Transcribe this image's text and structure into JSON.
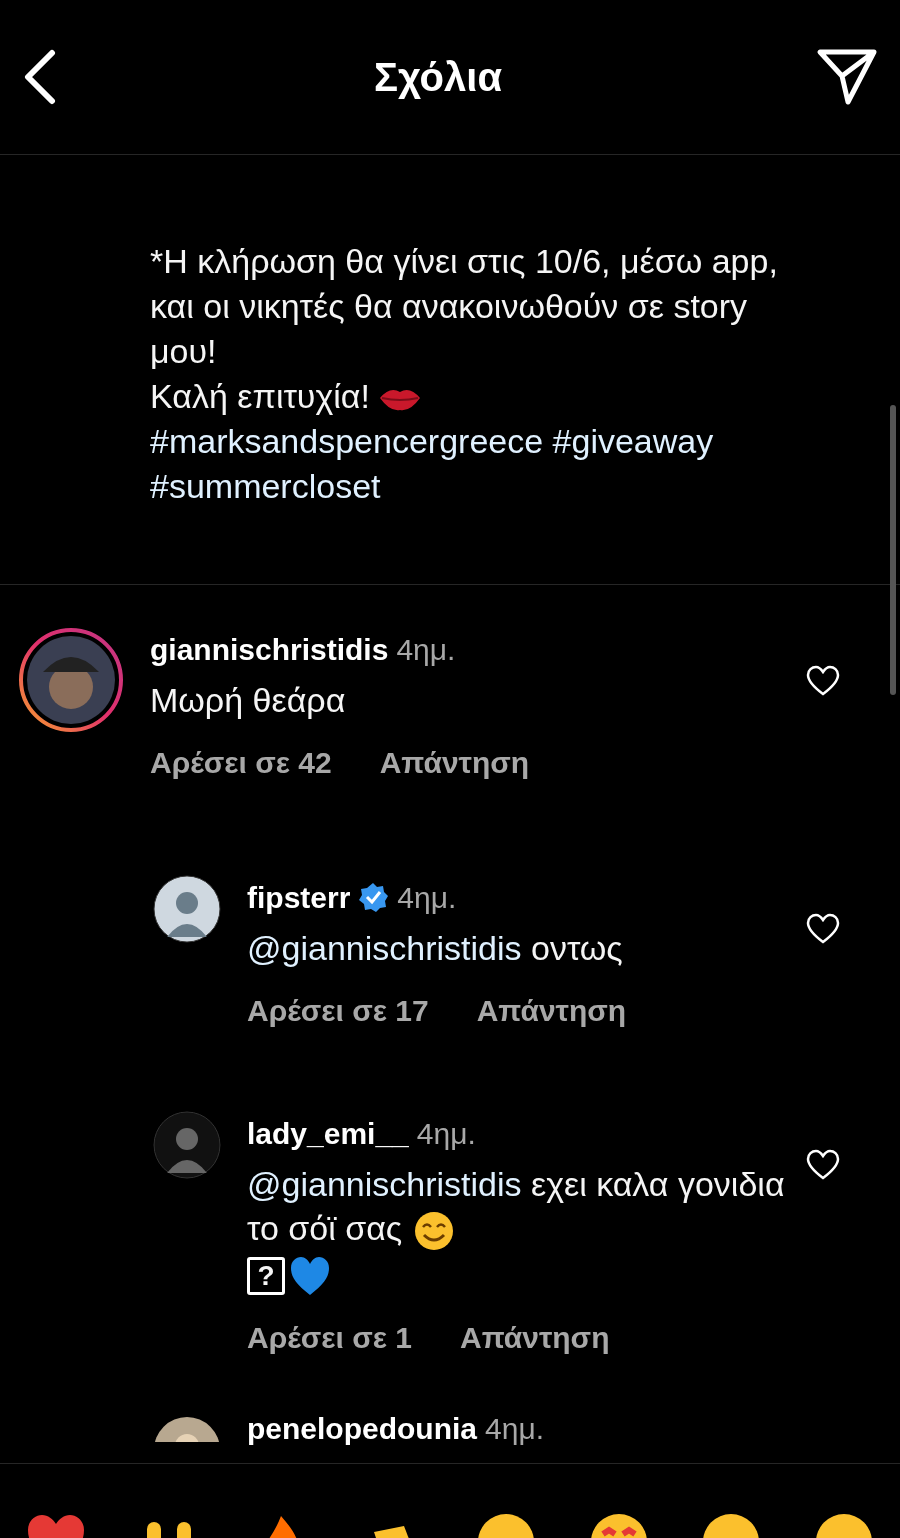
{
  "header": {
    "title": "Σχόλια"
  },
  "caption": {
    "paragraph": "*Η κλήρωση θα γίνει στις 10/6, μέσω app, και οι νικητές θα ανακοινωθούν σε story μου!",
    "closing": "Καλή επιτυχία!",
    "hashtags": [
      "#marksandspencergreece",
      "#giveaway",
      "#summercloset"
    ]
  },
  "comments": [
    {
      "kind": "top",
      "user": "giannischristidis",
      "verified": false,
      "time": "4ημ.",
      "text": "Μωρή θεάρα",
      "likes": "Αρέσει σε 42",
      "reply": "Απάντηση",
      "liked": false
    },
    {
      "kind": "reply",
      "user": "fipsterr",
      "verified": true,
      "time": "4ημ.",
      "mention": "@giannischristidis",
      "text": "οντως",
      "likes": "Αρέσει σε 17",
      "reply": "Απάντηση",
      "liked": false
    },
    {
      "kind": "reply",
      "user": "lady_emi__",
      "verified": false,
      "time": "4ημ.",
      "mention": "@giannischristidis",
      "text": "εχει καλα γονιδια το σόϊ σας",
      "glyph": "?",
      "likes": "Αρέσει σε 1",
      "reply": "Απάντηση",
      "liked": false
    }
  ],
  "partial_comment": {
    "user": "penelopedounia",
    "time": "4ημ."
  }
}
